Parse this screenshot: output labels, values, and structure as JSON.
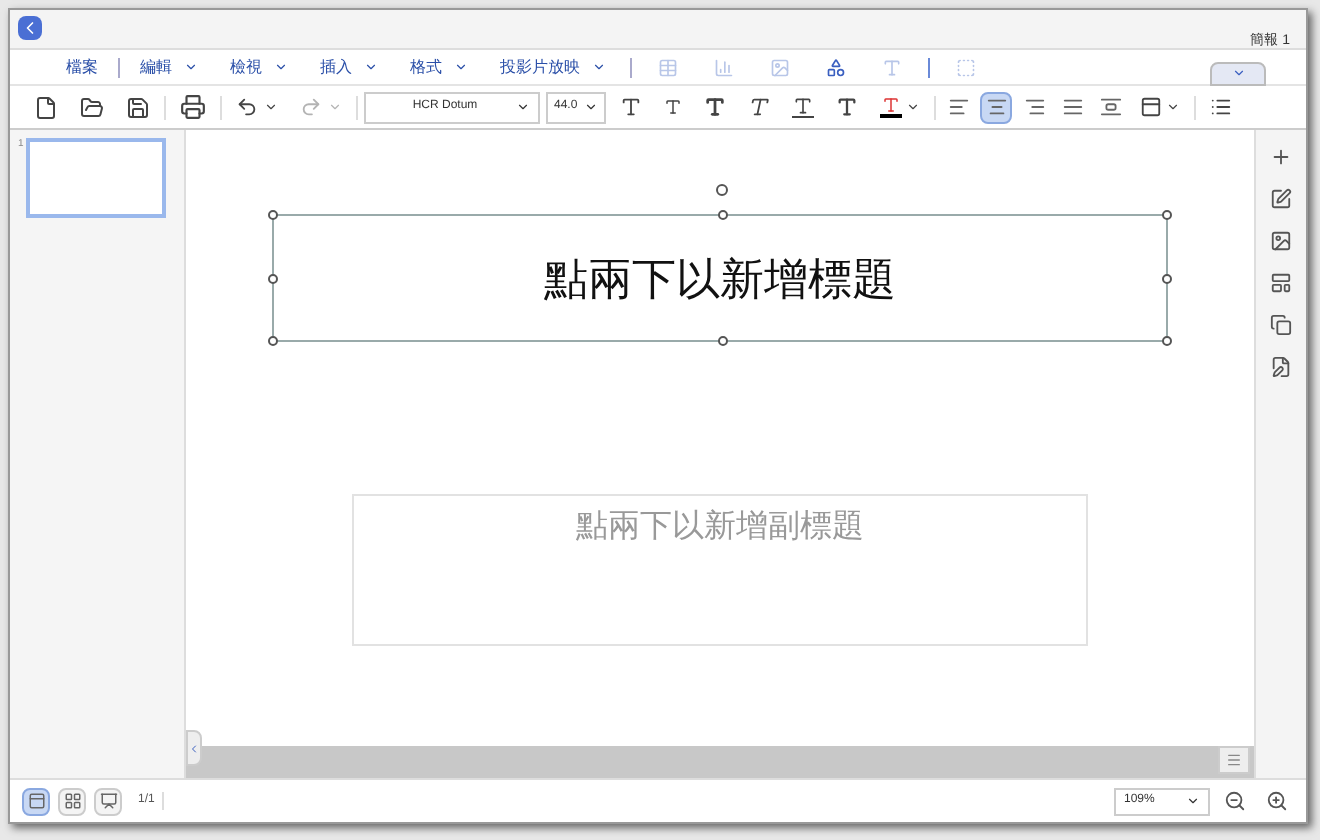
{
  "document_title": "簡報 1",
  "menus": [
    {
      "label": "檔案",
      "dropdown": false
    },
    {
      "label": "編輯",
      "dropdown": true
    },
    {
      "label": "檢視",
      "dropdown": true
    },
    {
      "label": "插入",
      "dropdown": true
    },
    {
      "label": "格式",
      "dropdown": true
    },
    {
      "label": "投影片放映",
      "dropdown": true
    }
  ],
  "insert_tools": [
    {
      "kind": "table",
      "disabled": true
    },
    {
      "kind": "chart",
      "disabled": true
    },
    {
      "kind": "image",
      "disabled": true
    },
    {
      "kind": "shapes",
      "disabled": false
    },
    {
      "kind": "textart",
      "disabled": true
    },
    {
      "kind": "separator"
    },
    {
      "kind": "textbox",
      "disabled": true
    }
  ],
  "toolbar": {
    "font": "HCR Dotum",
    "size": "44.0",
    "align": [
      {
        "kind": "left",
        "selected": false
      },
      {
        "kind": "center",
        "selected": true
      },
      {
        "kind": "right",
        "selected": false
      },
      {
        "kind": "justify",
        "selected": false
      },
      {
        "kind": "distribute",
        "selected": false
      }
    ]
  },
  "slides": [
    {
      "number": "1",
      "selected": true
    }
  ],
  "slide": {
    "title_placeholder": "點兩下以新增標題",
    "subtitle_placeholder": "點兩下以新增副標題"
  },
  "side_tools": [
    {
      "kind": "add"
    },
    {
      "kind": "shape"
    },
    {
      "kind": "image"
    },
    {
      "kind": "layout"
    },
    {
      "kind": "slides"
    },
    {
      "kind": "notes"
    }
  ],
  "views": [
    {
      "kind": "normal",
      "selected": true
    },
    {
      "kind": "sorter",
      "selected": false
    },
    {
      "kind": "show",
      "selected": false
    }
  ],
  "page": "1/1",
  "zoom": "109%"
}
